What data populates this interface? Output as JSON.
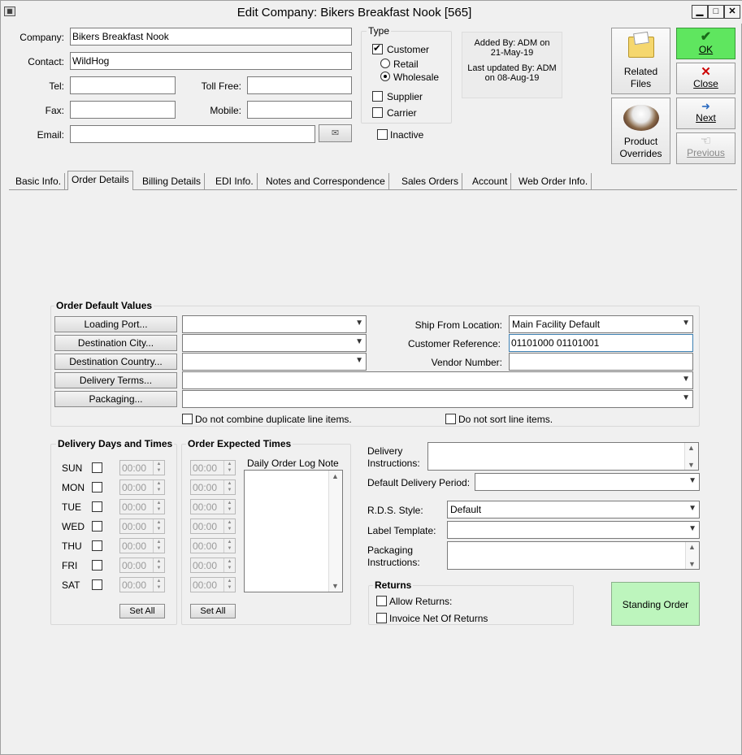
{
  "window": {
    "title": "Edit Company: Bikers Breakfast Nook [565]"
  },
  "header": {
    "company_label": "Company:",
    "company_value": "Bikers Breakfast Nook",
    "contact_label": "Contact:",
    "contact_value": "WildHog",
    "tel_label": "Tel:",
    "tel_value": "",
    "tollfree_label": "Toll Free:",
    "tollfree_value": "",
    "fax_label": "Fax:",
    "fax_value": "",
    "mobile_label": "Mobile:",
    "mobile_value": "",
    "email_label": "Email:",
    "email_value": ""
  },
  "type_group": {
    "title": "Type",
    "customer": "Customer",
    "customer_checked": true,
    "retail": "Retail",
    "wholesale": "Wholesale",
    "selected": "Wholesale",
    "supplier": "Supplier",
    "carrier": "Carrier",
    "inactive": "Inactive"
  },
  "audit": {
    "added_line1": "Added By: ADM on",
    "added_line2": "21-May-19",
    "updated_line1": "Last updated By: ADM",
    "updated_line2": "on 08-Aug-19"
  },
  "actions": {
    "related_files": "Related Files",
    "product_overrides": "Product Overrides",
    "ok": "OK",
    "close": "Close",
    "next": "Next",
    "previous": "Previous"
  },
  "tabs": [
    "Basic Info.",
    "Order Details",
    "Billing Details",
    "EDI Info.",
    "Notes and Correspondence",
    "Sales Orders",
    "Account",
    "Web Order Info."
  ],
  "active_tab": "Order Details",
  "order_defaults": {
    "title": "Order Default Values",
    "loading_port": "Loading Port...",
    "destination_city": "Destination City...",
    "destination_country": "Destination Country...",
    "delivery_terms": "Delivery Terms...",
    "packaging": "Packaging...",
    "ship_from_label": "Ship From Location:",
    "ship_from_value": "Main Facility Default",
    "customer_ref_label": "Customer Reference:",
    "customer_ref_value": "01101000 01101001",
    "vendor_label": "Vendor Number:",
    "vendor_value": "",
    "no_combine": "Do not combine duplicate line items.",
    "no_sort": "Do not sort line items."
  },
  "delivery_days": {
    "title": "Delivery Days and Times",
    "days": [
      "SUN",
      "MON",
      "TUE",
      "WED",
      "THU",
      "FRI",
      "SAT"
    ],
    "time": "00:00",
    "set_all": "Set All"
  },
  "expected_times": {
    "title": "Order Expected Times",
    "time": "00:00",
    "set_all": "Set All",
    "log_note_label": "Daily Order Log Note"
  },
  "delivery": {
    "instructions_label": "Delivery Instructions:",
    "period_label": "Default Delivery Period:",
    "period_value": "",
    "rds_label": "R.D.S. Style:",
    "rds_value": "Default",
    "label_template_label": "Label Template:",
    "label_template_value": "",
    "packaging_instr_label": "Packaging Instructions:"
  },
  "returns": {
    "title": "Returns",
    "allow": "Allow Returns:",
    "invoice_net": "Invoice Net Of Returns"
  },
  "standing_order": "Standing Order",
  "colors": {
    "ok_green": "#5fe65f",
    "standing_green": "#bdf5bd"
  }
}
